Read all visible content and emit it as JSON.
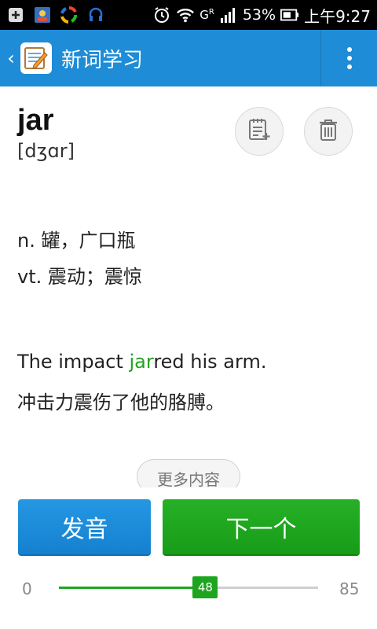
{
  "status_bar": {
    "battery": "53%",
    "time": "上午9:27",
    "network": "G",
    "network_sub": "R"
  },
  "action_bar": {
    "title": "新词学习",
    "icons": {
      "back": "chevron-left-icon",
      "app": "notebook-pencil-icon",
      "menu": "overflow-menu-icon"
    }
  },
  "word": {
    "text": "jar",
    "phonetic": "[dʒɑr]"
  },
  "actions": {
    "icons": {
      "note": "add-note-icon",
      "delete": "trash-icon"
    }
  },
  "definitions": [
    "n. 罐，广口瓶",
    "vt. 震动；震惊"
  ],
  "example": {
    "before": "The impact ",
    "highlight": "jar",
    "after": "red his arm.",
    "translation": "冲击力震伤了他的胳膊。"
  },
  "more_button": "更多内容",
  "buttons": {
    "pronounce": "发音",
    "next": "下一个"
  },
  "progress": {
    "min": "0",
    "max": "85",
    "current": "48",
    "fraction": 0.565
  },
  "colors": {
    "action_bar": "#1e8cd6",
    "accent_green": "#1ea51e",
    "button_blue": "#1e8cd6"
  }
}
